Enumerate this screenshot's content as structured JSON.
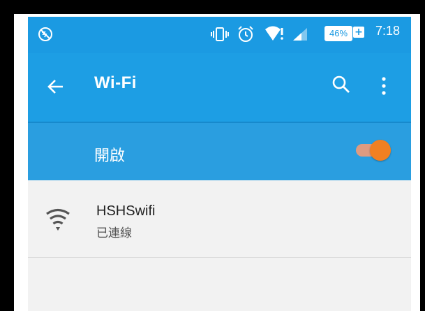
{
  "status_bar": {
    "time": "7:18",
    "battery_percent": "46%",
    "battery_charging_symbol": "+",
    "icons": [
      "no-data-icon",
      "vibrate-icon",
      "alarm-icon",
      "wifi-signal-icon",
      "cell-signal-icon"
    ]
  },
  "app_bar": {
    "title": "Wi-Fi",
    "back_icon": "arrow-back-icon",
    "search_icon": "search-icon",
    "more_icon": "more-vert-icon"
  },
  "switch_bar": {
    "label": "開啟",
    "enabled": true,
    "accent_color": "#f08022"
  },
  "networks": [
    {
      "ssid": "HSHSwifi",
      "status": "已連線",
      "icon": "wifi-full-icon"
    }
  ],
  "colors": {
    "primary": "#1d9ee4",
    "status_bar": "#1b9ae2",
    "list_bg": "#f2f2f2"
  }
}
